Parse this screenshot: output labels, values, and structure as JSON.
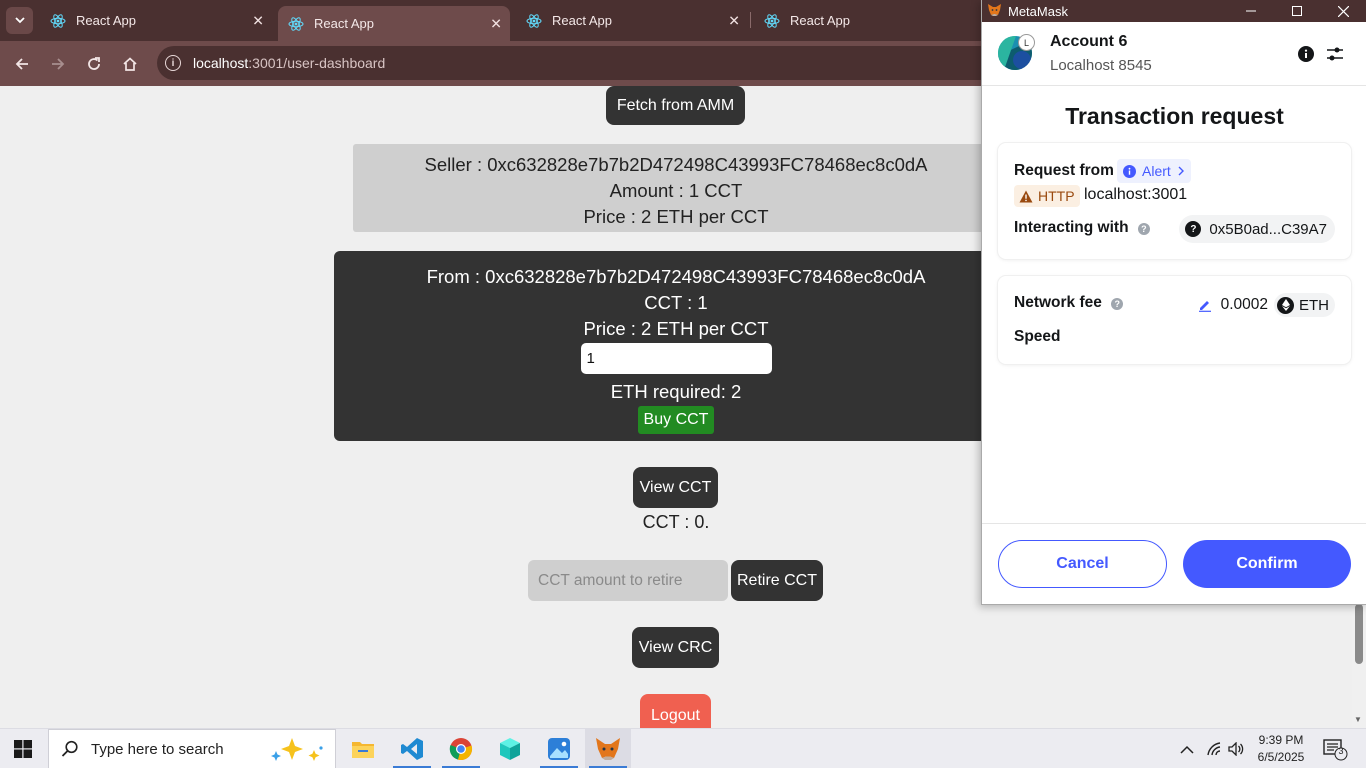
{
  "browser": {
    "tabs": [
      {
        "title": "React App",
        "active": false
      },
      {
        "title": "React App",
        "active": true
      },
      {
        "title": "React App",
        "active": false
      },
      {
        "title": "React App",
        "active": false
      }
    ],
    "url_host": "localhost",
    "url_path": ":3001/user-dashboard"
  },
  "page": {
    "fetch_button": "Fetch from AMM",
    "seller_listing": {
      "seller": "Seller : 0xc632828e7b7b2D472498C43993FC78468ec8c0dA",
      "amount": "Amount : 1 CCT",
      "price": "Price : 2 ETH per CCT"
    },
    "buy_panel": {
      "from": "From : 0xc632828e7b7b2D472498C43993FC78468ec8c0dA",
      "cct": "CCT : 1",
      "price": "Price : 2 ETH per CCT",
      "quantity_value": "1",
      "eth_required": "ETH required: 2",
      "buy_button": "Buy CCT"
    },
    "view_cct_button": "View CCT",
    "cct_balance": "CCT : 0.",
    "retire_placeholder": "CCT amount to retire",
    "retire_button": "Retire CCT",
    "view_crc_button": "View CRC",
    "logout_button": "Logout"
  },
  "metamask": {
    "window_title": "MetaMask",
    "account_name": "Account 6",
    "avatar_badge": "L",
    "network": "Localhost 8545",
    "title": "Transaction request",
    "request_from_label": "Request from",
    "alert_label": "Alert",
    "http_label": "HTTP",
    "origin": "localhost:3001",
    "interacting_with_label": "Interacting with",
    "contract_address": "0x5B0ad...C39A7",
    "network_fee_label": "Network fee",
    "fee_amount": "0.0002",
    "fee_currency": "ETH",
    "speed_label": "Speed",
    "cancel_button": "Cancel",
    "confirm_button": "Confirm"
  },
  "taskbar": {
    "search_placeholder": "Type here to search",
    "time": "9:39 PM",
    "date": "6/5/2025",
    "notification_count": "3"
  },
  "colors": {
    "browser_frame": "#6e4b4b",
    "buy_button": "#228b22",
    "logout_button": "#f06050",
    "metamask_primary": "#4459ff"
  }
}
